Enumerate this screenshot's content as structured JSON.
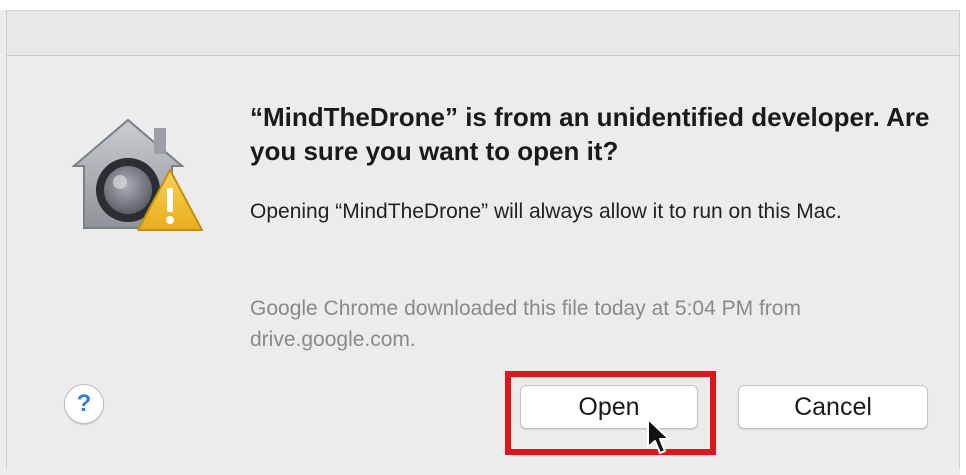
{
  "dialog": {
    "headline": "“MindTheDrone” is from an unidentified developer. Are you sure you want to open it?",
    "message": "Opening “MindTheDrone” will always allow it to run on this Mac.",
    "source_info": "Google Chrome downloaded this file today at 5:04 PM from drive.google.com.",
    "icon": "gatekeeper-warning-icon"
  },
  "buttons": {
    "help_label": "?",
    "open_label": "Open",
    "cancel_label": "Cancel"
  },
  "colors": {
    "highlight": "#e0141c",
    "help_accent": "#2f7fd9",
    "warning_yellow": "#f2c12e"
  }
}
